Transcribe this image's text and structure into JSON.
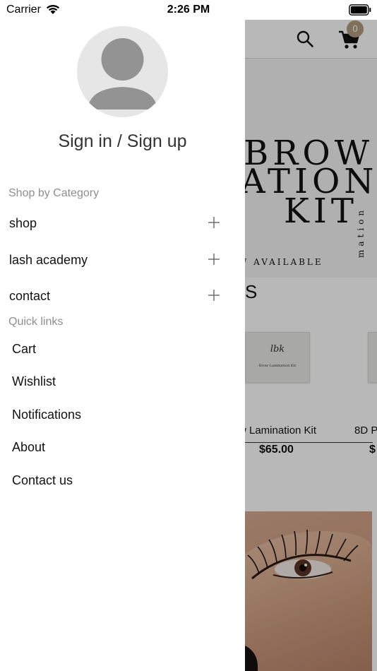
{
  "status_bar": {
    "carrier": "Carrier",
    "time": "2:26 PM"
  },
  "drawer": {
    "sign_in_label": "Sign in / Sign up",
    "shop_by_category_heading": "Shop by Category",
    "categories": [
      {
        "label": "shop"
      },
      {
        "label": "lash academy"
      },
      {
        "label": "contact"
      }
    ],
    "quick_links_heading": "Quick links",
    "quick_links": [
      {
        "label": "Cart"
      },
      {
        "label": "Wishlist"
      },
      {
        "label": "Notifications"
      },
      {
        "label": "About"
      },
      {
        "label": "Contact us"
      }
    ]
  },
  "background_app": {
    "header_fragment": "‹",
    "cart_count": "0",
    "banner": {
      "line1": "BROW",
      "line2": "ATION",
      "line3": "KIT",
      "available_text": "W AVAILABLE",
      "vertical_text": "mation"
    },
    "section_title_fragment": "S",
    "products": [
      {
        "name": "w Lamination Kit",
        "price": "$65.00",
        "image_logo": "lbk",
        "image_text": "Brow Lamination Kit"
      },
      {
        "name": "8D P",
        "price": "$"
      }
    ]
  },
  "colors": {
    "cart_badge": "#b29d82",
    "muted_text": "#8e8e8e",
    "overlay": "rgba(0,0,0,0.28)"
  },
  "icons": [
    "wifi-icon",
    "battery-icon",
    "avatar-icon",
    "plus-icon",
    "search-icon",
    "cart-icon"
  ]
}
